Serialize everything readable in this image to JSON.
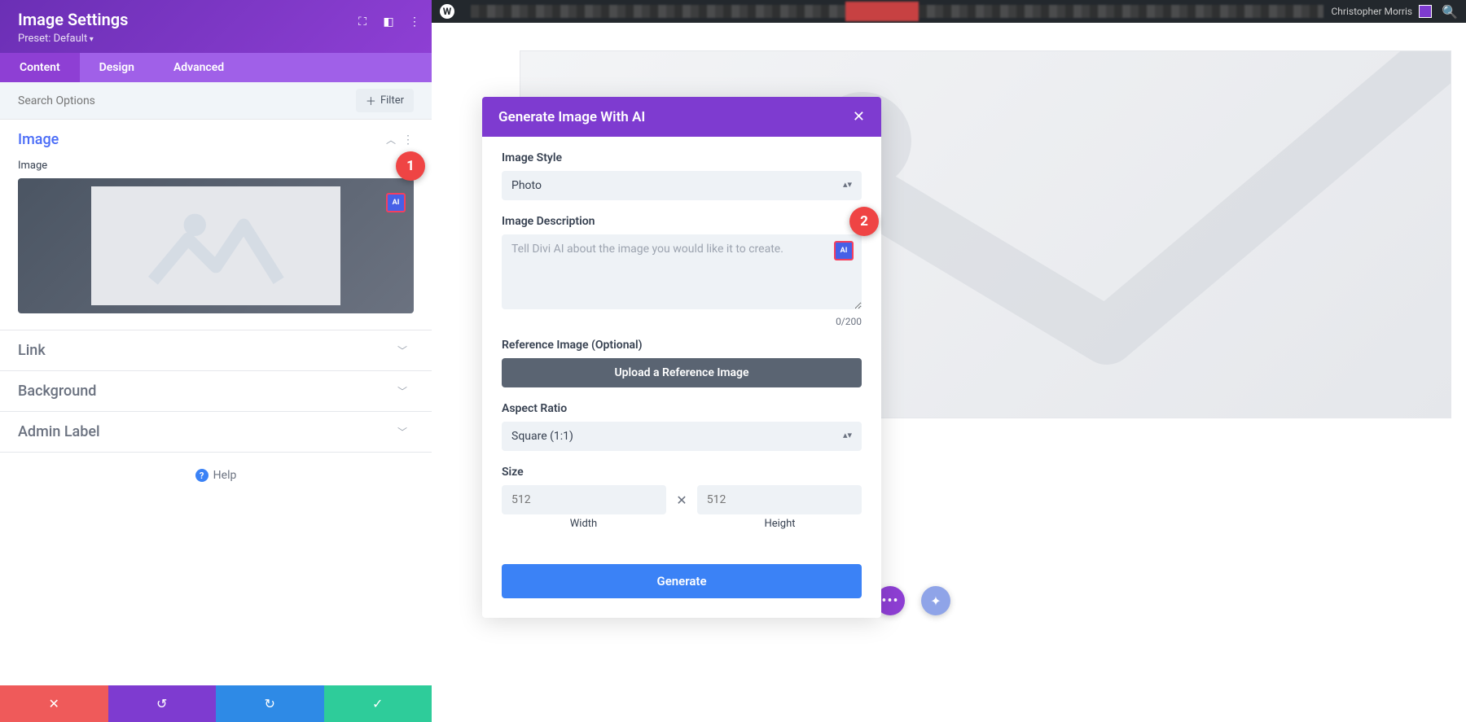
{
  "sidebar": {
    "title": "Image Settings",
    "preset": "Preset: Default",
    "tabs": {
      "content": "Content",
      "design": "Design",
      "advanced": "Advanced"
    },
    "search_placeholder": "Search Options",
    "filter": "Filter",
    "sections": {
      "image": {
        "title": "Image",
        "field_label": "Image"
      },
      "link": "Link",
      "background": "Background",
      "admin_label": "Admin Label"
    },
    "help": "Help",
    "ai_badge": "AI"
  },
  "wp_bar": {
    "user": "Christopher Morris"
  },
  "modal": {
    "title": "Generate Image With AI",
    "style_label": "Image Style",
    "style_value": "Photo",
    "desc_label": "Image Description",
    "desc_placeholder": "Tell Divi AI about the image you would like it to create.",
    "counter": "0/200",
    "ref_label": "Reference Image (Optional)",
    "upload_btn": "Upload a Reference Image",
    "aspect_label": "Aspect Ratio",
    "aspect_value": "Square (1:1)",
    "size_label": "Size",
    "width_value": "512",
    "height_value": "512",
    "width_label": "Width",
    "height_label": "Height",
    "generate": "Generate",
    "ai_badge": "AI"
  },
  "callouts": {
    "one": "1",
    "two": "2"
  }
}
